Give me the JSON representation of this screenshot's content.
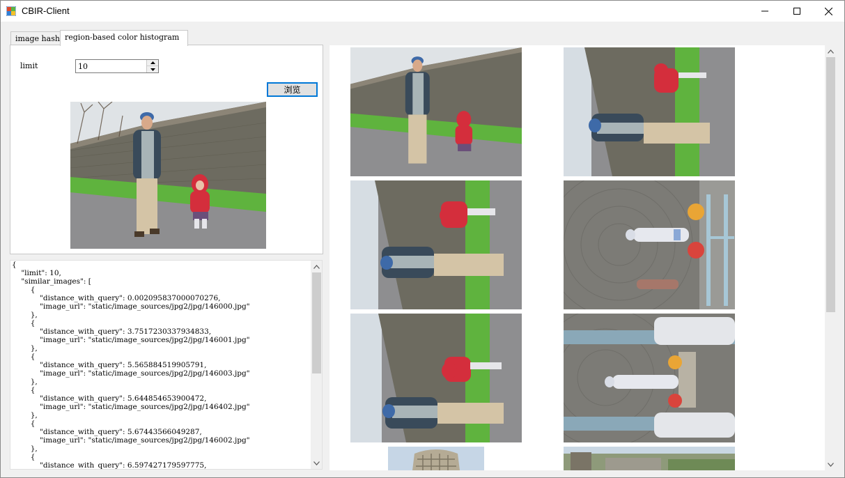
{
  "window": {
    "title": "CBIR-Client",
    "icon": "windows-form-icon",
    "controls": {
      "minimize": "minimize-icon",
      "maximize": "maximize-icon",
      "close": "close-icon"
    }
  },
  "tabs": [
    {
      "label": "image hash",
      "active": false
    },
    {
      "label": "region-based color histogram",
      "active": true
    }
  ],
  "form": {
    "limit_label": "limit",
    "limit_value": "10",
    "browse_label": "浏览"
  },
  "query_image": {
    "description_icon": "query-photo"
  },
  "response_json": "{\n    \"limit\": 10,\n    \"similar_images\": [\n        {\n            \"distance_with_query\": 0.002095837000070276,\n            \"image_url\": \"static/image_sources/jpg2/jpg/146000.jpg\"\n        },\n        {\n            \"distance_with_query\": 3.7517230337934833,\n            \"image_url\": \"static/image_sources/jpg2/jpg/146001.jpg\"\n        },\n        {\n            \"distance_with_query\": 5.565884519905791,\n            \"image_url\": \"static/image_sources/jpg2/jpg/146003.jpg\"\n        },\n        {\n            \"distance_with_query\": 5.644854653900472,\n            \"image_url\": \"static/image_sources/jpg2/jpg/146402.jpg\"\n        },\n        {\n            \"distance_with_query\": 5.67443566049287,\n            \"image_url\": \"static/image_sources/jpg2/jpg/146002.jpg\"\n        },\n        {\n            \"distance_with_query\": 6.597427179597775,",
  "results": [
    {
      "kind": "wall-upright"
    },
    {
      "kind": "wall-rotated"
    },
    {
      "kind": "wall-rotated"
    },
    {
      "kind": "statue-rotated"
    },
    {
      "kind": "wall-rotated"
    },
    {
      "kind": "statue-columns"
    },
    {
      "kind": "tower"
    },
    {
      "kind": "town"
    }
  ],
  "colors": {
    "accent": "#0078d7",
    "tab_border": "#c8c8c8",
    "scrollbar_thumb": "#cdcdcd"
  }
}
